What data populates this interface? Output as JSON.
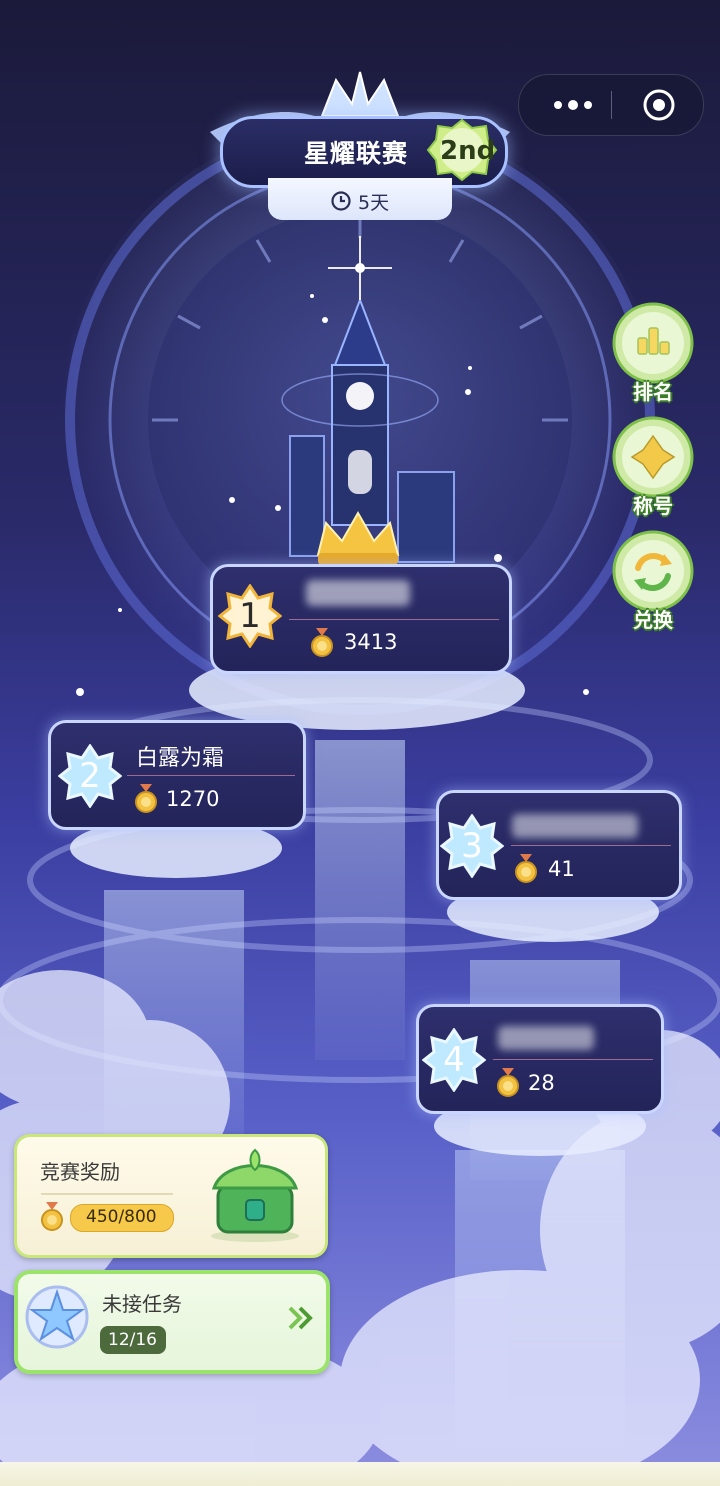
{
  "miniapp_capsule": {
    "more_icon": "more-dots-icon",
    "close_icon": "target-close-icon"
  },
  "header": {
    "title": "星耀联赛",
    "season_badge": "2nd",
    "timer_icon": "clock-icon",
    "timer_text": "5天"
  },
  "side_menu": [
    {
      "label": "排名",
      "icon": "ranking-bars-icon"
    },
    {
      "label": "称号",
      "icon": "title-badge-icon"
    },
    {
      "label": "兑换",
      "icon": "exchange-arrows-icon"
    }
  ],
  "leaderboard": [
    {
      "rank": "1",
      "name": "",
      "score": "3413",
      "name_blurred": true
    },
    {
      "rank": "2",
      "name": "白露为霜",
      "score": "1270",
      "name_blurred": false
    },
    {
      "rank": "3",
      "name": "",
      "score": "41",
      "name_blurred": true
    },
    {
      "rank": "4",
      "name": "",
      "score": "28",
      "name_blurred": true
    }
  ],
  "reward_panel": {
    "title": "竞赛奖励",
    "progress": "450/800",
    "progress_fraction": 0.5625,
    "chest_icon": "leaf-treasure-chest-icon"
  },
  "task_panel": {
    "title": "未接任务",
    "count": "12/16",
    "arrow_icon": "double-chevron-right-icon"
  },
  "colors": {
    "accent_green": "#9be36a",
    "gold": "#f6c94a",
    "card_bg": "#2b2c68",
    "card_border": "#c9d6ff"
  }
}
